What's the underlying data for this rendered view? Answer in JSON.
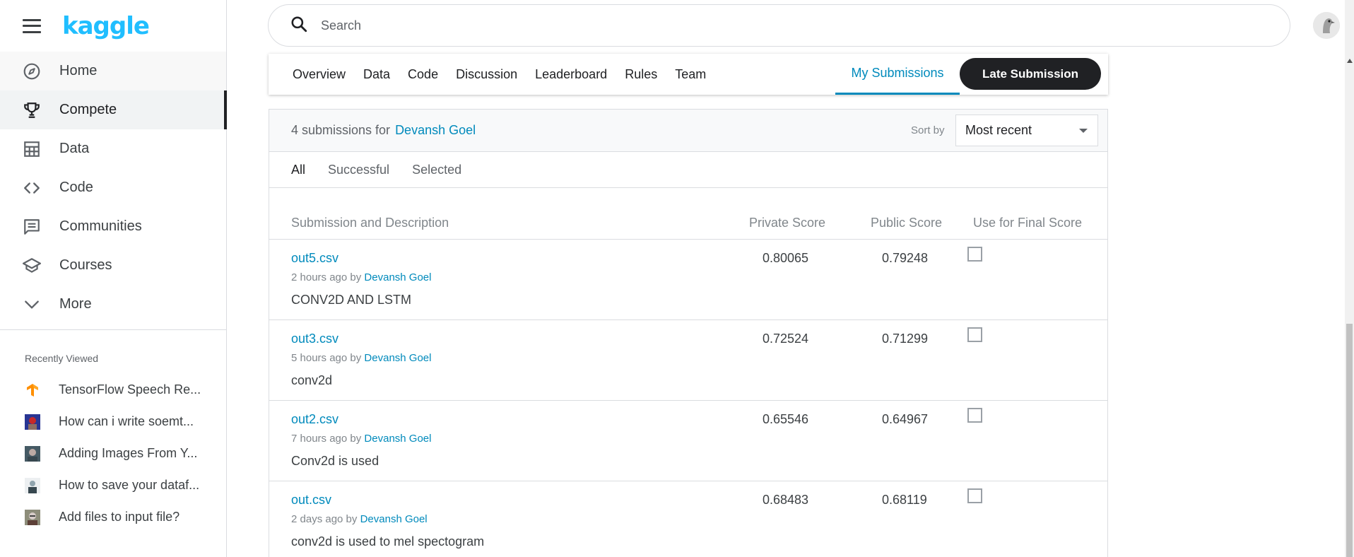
{
  "sidebar": {
    "logo": "kaggle",
    "nav": [
      {
        "label": "Home",
        "icon": "compass-icon"
      },
      {
        "label": "Compete",
        "icon": "trophy-icon"
      },
      {
        "label": "Data",
        "icon": "table-icon"
      },
      {
        "label": "Code",
        "icon": "code-icon"
      },
      {
        "label": "Communities",
        "icon": "comments-icon"
      },
      {
        "label": "Courses",
        "icon": "school-icon"
      },
      {
        "label": "More",
        "icon": "chevron-down-icon"
      }
    ],
    "recent_title": "Recently Viewed",
    "recent": [
      {
        "label": "TensorFlow Speech Re..."
      },
      {
        "label": "How can i write soemt..."
      },
      {
        "label": "Adding Images From Y..."
      },
      {
        "label": "How to save your dataf..."
      },
      {
        "label": "Add files to input file?"
      }
    ]
  },
  "search": {
    "placeholder": "Search"
  },
  "tabs": {
    "items": [
      "Overview",
      "Data",
      "Code",
      "Discussion",
      "Leaderboard",
      "Rules",
      "Team"
    ],
    "my_submissions": "My Submissions",
    "late_submission": "Late Submission"
  },
  "panel": {
    "count_text": "4 submissions for",
    "user": "Devansh Goel",
    "sort_label": "Sort by",
    "sort_value": "Most recent",
    "filters": [
      "All",
      "Successful",
      "Selected"
    ],
    "headers": {
      "submission": "Submission and Description",
      "private": "Private Score",
      "public": "Public Score",
      "final": "Use for Final Score"
    },
    "rows": [
      {
        "file": "out5.csv",
        "time": "2 hours ago by",
        "by": "Devansh Goel",
        "desc": "CONV2D AND LSTM",
        "private": "0.80065",
        "public": "0.79248"
      },
      {
        "file": "out3.csv",
        "time": "5 hours ago by",
        "by": "Devansh Goel",
        "desc": "conv2d",
        "private": "0.72524",
        "public": "0.71299"
      },
      {
        "file": "out2.csv",
        "time": "7 hours ago by",
        "by": "Devansh Goel",
        "desc": "Conv2d is used",
        "private": "0.65546",
        "public": "0.64967"
      },
      {
        "file": "out.csv",
        "time": "2 days ago by",
        "by": "Devansh Goel",
        "desc": "conv2d is used to mel spectogram",
        "private": "0.68483",
        "public": "0.68119"
      }
    ]
  },
  "colors": {
    "accent": "#008abc",
    "logo": "#20beff",
    "dark": "#202124"
  }
}
